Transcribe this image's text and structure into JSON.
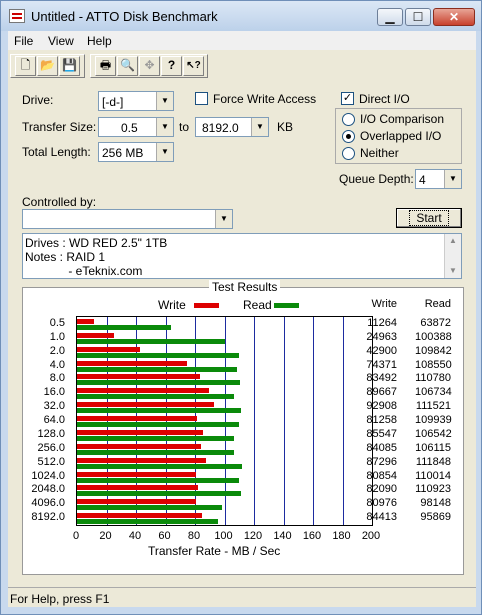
{
  "window": {
    "title": "Untitled - ATTO Disk Benchmark",
    "min_label": "▁",
    "max_label": "☐",
    "close_label": "✕"
  },
  "menu": [
    "File",
    "View",
    "Help"
  ],
  "toolbar": {
    "buttons": [
      {
        "icon": "new-document-icon",
        "glyph": "🗋"
      },
      {
        "icon": "open-folder-icon",
        "glyph": "📂"
      },
      {
        "icon": "save-icon",
        "glyph": "💾"
      },
      {
        "icon": "print-icon",
        "glyph": "🖶"
      },
      {
        "icon": "print-preview-icon",
        "glyph": "🔍"
      },
      {
        "icon": "move-icon",
        "glyph": "✥"
      },
      {
        "icon": "help-icon",
        "glyph": "?"
      },
      {
        "icon": "context-help-icon",
        "glyph": "↖?"
      }
    ]
  },
  "form": {
    "drive_label": "Drive:",
    "drive_value": "[-d-]",
    "force_write_label": "Force Write Access",
    "force_write_checked": false,
    "direct_io_label": "Direct I/O",
    "direct_io_checked": true,
    "transfer_size_label": "Transfer Size:",
    "transfer_from": "0.5",
    "to_label": "to",
    "transfer_to": "8192.0",
    "kb_label": "KB",
    "total_length_label": "Total Length:",
    "total_length_value": "256 MB",
    "io_options": [
      {
        "label": "I/O Comparison",
        "selected": false
      },
      {
        "label": "Overlapped I/O",
        "selected": true
      },
      {
        "label": "Neither",
        "selected": false
      }
    ],
    "queue_depth_label": "Queue Depth:",
    "queue_depth_value": "4",
    "controlled_by_label": "Controlled by:",
    "controlled_by_value": "",
    "start_label": "Start"
  },
  "notes": {
    "lines": [
      "Drives : WD RED 2.5\" 1TB",
      "Notes : RAID 1",
      "             - eTeknix.com"
    ]
  },
  "chart_data": {
    "type": "bar",
    "title": "Test Results",
    "xlabel": "Transfer Rate - MB / Sec",
    "xlim": [
      0,
      200
    ],
    "xticks": [
      "0",
      "20",
      "40",
      "60",
      "80",
      "100",
      "120",
      "140",
      "160",
      "180",
      "200"
    ],
    "categories": [
      "0.5",
      "1.0",
      "2.0",
      "4.0",
      "8.0",
      "16.0",
      "32.0",
      "64.0",
      "128.0",
      "256.0",
      "512.0",
      "1024.0",
      "2048.0",
      "4096.0",
      "8192.0"
    ],
    "series": [
      {
        "name": "Write",
        "color": "#dd0000",
        "values": [
          11264,
          24963,
          42900,
          74371,
          83492,
          89667,
          92908,
          81258,
          85547,
          84085,
          87296,
          80854,
          82090,
          80976,
          84413
        ]
      },
      {
        "name": "Read",
        "color": "#0a8a0a",
        "values": [
          63872,
          100388,
          109842,
          108550,
          110780,
          106734,
          111521,
          109939,
          106542,
          106115,
          111848,
          110014,
          110923,
          98148,
          95869
        ]
      }
    ],
    "columns": {
      "write_header": "Write",
      "read_header": "Read"
    },
    "legend": "top",
    "value_unit_divisor": 1000
  },
  "status": {
    "text": "For Help, press F1"
  }
}
